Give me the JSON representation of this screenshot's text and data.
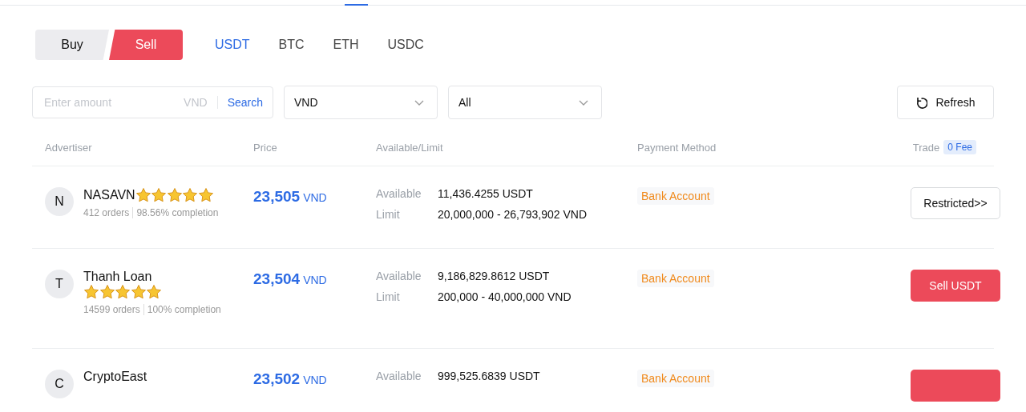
{
  "side_toggle": [
    {
      "label": "Buy",
      "selected": false
    },
    {
      "label": "Sell",
      "selected": true
    }
  ],
  "coin_tabs": [
    {
      "label": "USDT",
      "selected": true
    },
    {
      "label": "BTC",
      "selected": false
    },
    {
      "label": "ETH",
      "selected": false
    },
    {
      "label": "USDC",
      "selected": false
    }
  ],
  "amount_field": {
    "placeholder": "Enter amount",
    "unit": "VND",
    "action": "Search"
  },
  "selects": [
    {
      "value": "VND"
    },
    {
      "value": "All"
    }
  ],
  "refresh_button": {
    "label": "Refresh"
  },
  "table": {
    "columns": [
      {
        "label": "Advertiser"
      },
      {
        "label": "Price"
      },
      {
        "label": "Available/Limit"
      },
      {
        "label": "Payment Method"
      },
      {
        "label": "Trade",
        "badge": "0 Fee"
      }
    ],
    "rows": [
      {
        "initial": "N",
        "name": "NASAVN",
        "stars": 5,
        "orders": "412 orders",
        "completion": "98.56% completion",
        "price": "23,505",
        "currency": "VND",
        "available_label": "Available",
        "available": "11,436.4255 USDT",
        "limit_label": "Limit",
        "limit": "20,000,000 - 26,793,902 VND",
        "payment": "Bank Account",
        "trade": {
          "kind": "restricted",
          "label": "Restricted>>"
        }
      },
      {
        "initial": "T",
        "name": "Thanh Loan",
        "stars": 5,
        "orders": "14599 orders",
        "completion": "100% completion",
        "price": "23,504",
        "currency": "VND",
        "available_label": "Available",
        "available": "9,186,829.8612 USDT",
        "limit_label": "Limit",
        "limit": "200,000 - 40,000,000 VND",
        "payment": "Bank Account",
        "trade": {
          "kind": "sell",
          "label": "Sell USDT"
        }
      },
      {
        "initial": "C",
        "name": "CryptoEast",
        "price": "23,502",
        "currency": "VND",
        "available_label": "Available",
        "available": "999,525.6839 USDT",
        "payment": "Bank Account",
        "trade": {
          "kind": "sell"
        }
      }
    ]
  }
}
